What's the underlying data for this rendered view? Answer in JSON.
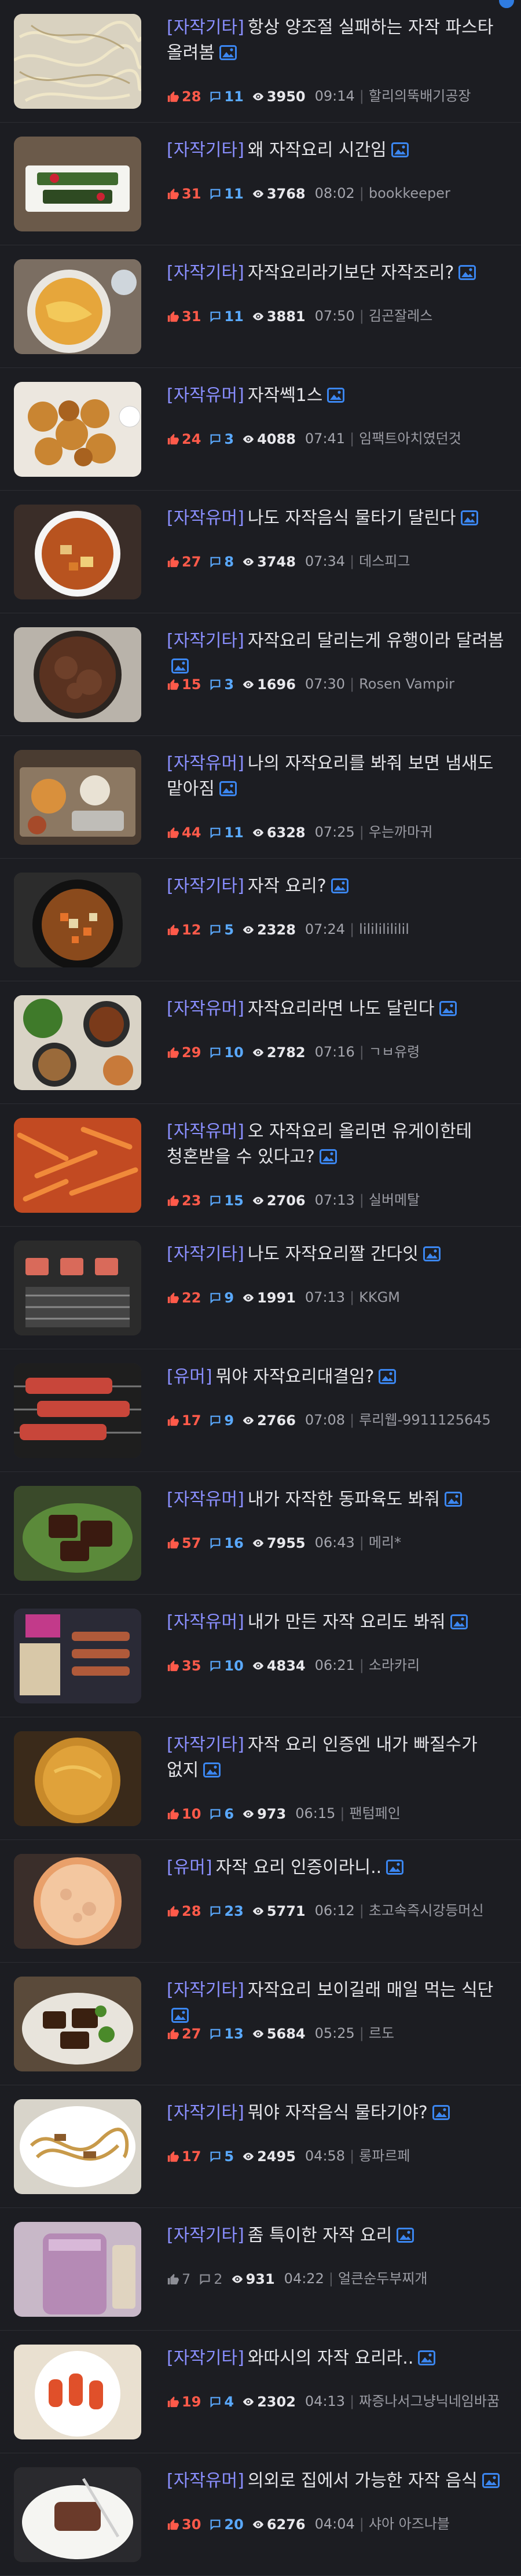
{
  "posts": [
    {
      "category": "[자작기타]",
      "title": "항상 양조절 실패하는 자작 파스타 올려봄",
      "likes": "28",
      "comments": "11",
      "views": "3950",
      "time": "09:14",
      "author": "할리의뚝배기공장",
      "thumb": "pasta"
    },
    {
      "category": "[자작기타]",
      "title": "왜 자작요리 시간임",
      "likes": "31",
      "comments": "11",
      "views": "3768",
      "time": "08:02",
      "author": "bookkeeper",
      "thumb": "plate"
    },
    {
      "category": "[자작기타]",
      "title": "자작요리라기보단 자작조리?",
      "likes": "31",
      "comments": "11",
      "views": "3881",
      "time": "07:50",
      "author": "김곤잘레스",
      "thumb": "egg"
    },
    {
      "category": "[자작유머]",
      "title": "자작쎅1스",
      "likes": "24",
      "comments": "3",
      "views": "4088",
      "time": "07:41",
      "author": "임팩트아치였던것",
      "thumb": "chicken"
    },
    {
      "category": "[자작유머]",
      "title": "나도 자작음식 물타기 달린다",
      "likes": "27",
      "comments": "8",
      "views": "3748",
      "time": "07:34",
      "author": "데스피그",
      "thumb": "stew"
    },
    {
      "category": "[자작기타]",
      "title": "자작요리 달리는게 유행이라 달려봄",
      "likes": "15",
      "comments": "3",
      "views": "1696",
      "time": "07:30",
      "author": "Rosen Vampir",
      "thumb": "pan"
    },
    {
      "category": "[자작유머]",
      "title": "나의 자작요리를 봐줘 보면 냄새도 맡아짐",
      "likes": "44",
      "comments": "11",
      "views": "6328",
      "time": "07:25",
      "author": "우는까마귀",
      "thumb": "tray"
    },
    {
      "category": "[자작기타]",
      "title": "자작 요리?",
      "likes": "12",
      "comments": "5",
      "views": "2328",
      "time": "07:24",
      "author": "lilililililil",
      "thumb": "wok"
    },
    {
      "category": "[자작유머]",
      "title": "자작요리라면 나도 달린다",
      "likes": "29",
      "comments": "10",
      "views": "2782",
      "time": "07:16",
      "author": "ㄱㅂ유령",
      "thumb": "bowls"
    },
    {
      "category": "[자작유머]",
      "title": "오 자작요리 올리면 유게이한테 청혼받을 수 있다고?",
      "likes": "23",
      "comments": "15",
      "views": "2706",
      "time": "07:13",
      "author": "실버메탈",
      "thumb": "fries"
    },
    {
      "category": "[자작기타]",
      "title": "나도 자작요리짤 간다잇",
      "likes": "22",
      "comments": "9",
      "views": "1991",
      "time": "07:13",
      "author": "KKGM",
      "thumb": "grill"
    },
    {
      "category": "[유머]",
      "title": "뭐야 자작요리대결임?",
      "likes": "17",
      "comments": "9",
      "views": "2766",
      "time": "07:08",
      "author": "루리웹-9911125645",
      "thumb": "grill2"
    },
    {
      "category": "[자작유머]",
      "title": "내가 자작한 동파육도 봐줘",
      "likes": "57",
      "comments": "16",
      "views": "7955",
      "time": "06:43",
      "author": "메리*",
      "thumb": "pork"
    },
    {
      "category": "[자작유머]",
      "title": "내가 만든 자작 요리도 봐줘",
      "likes": "35",
      "comments": "10",
      "views": "4834",
      "time": "06:21",
      "author": "소라카리",
      "thumb": "skewer"
    },
    {
      "category": "[자작기타]",
      "title": "자작 요리 인증엔 내가 빠질수가 없지",
      "likes": "10",
      "comments": "6",
      "views": "973",
      "time": "06:15",
      "author": "팬텀페인",
      "thumb": "curry"
    },
    {
      "category": "[유머]",
      "title": "자작 요리 인증이라니..",
      "likes": "28",
      "comments": "23",
      "views": "5771",
      "time": "06:12",
      "author": "초고속즉시강등머신",
      "thumb": "pizza"
    },
    {
      "category": "[자작기타]",
      "title": "자작요리 보이길래 매일 먹는 식단",
      "likes": "27",
      "comments": "13",
      "views": "5684",
      "time": "05:25",
      "author": "르도",
      "thumb": "meat"
    },
    {
      "category": "[자작기타]",
      "title": "뭐야 자작음식 물타기야?",
      "likes": "17",
      "comments": "5",
      "views": "2495",
      "time": "04:58",
      "author": "롱파르페",
      "thumb": "noodle"
    },
    {
      "category": "[자작기타]",
      "title": "좀 특이한 자작 요리",
      "likes": "7",
      "comments": "2",
      "views": "931",
      "time": "04:22",
      "author": "얼큰순두부찌개",
      "thumb": "smoothie",
      "gray": true
    },
    {
      "category": "[자작기타]",
      "title": "와따시의 자작 요리라..",
      "likes": "19",
      "comments": "4",
      "views": "2302",
      "time": "04:13",
      "author": "짜증나서그냥닉네임바꿈",
      "thumb": "tteok"
    },
    {
      "category": "[자작유머]",
      "title": "의외로 집에서 가능한 자작 음식",
      "likes": "30",
      "comments": "20",
      "views": "6276",
      "time": "04:04",
      "author": "샤아 아즈나블",
      "thumb": "rice"
    }
  ],
  "icons": {
    "like": "thumbs-up-icon",
    "comment": "speech-bubble-icon",
    "view": "eye-icon",
    "image": "image-attachment-icon"
  },
  "colors": {
    "background": "#1c1d22",
    "category": "#8a8fff",
    "likes": "#ff5a4a",
    "comments": "#5aa9ff",
    "image_icon": "#3b86f0"
  }
}
